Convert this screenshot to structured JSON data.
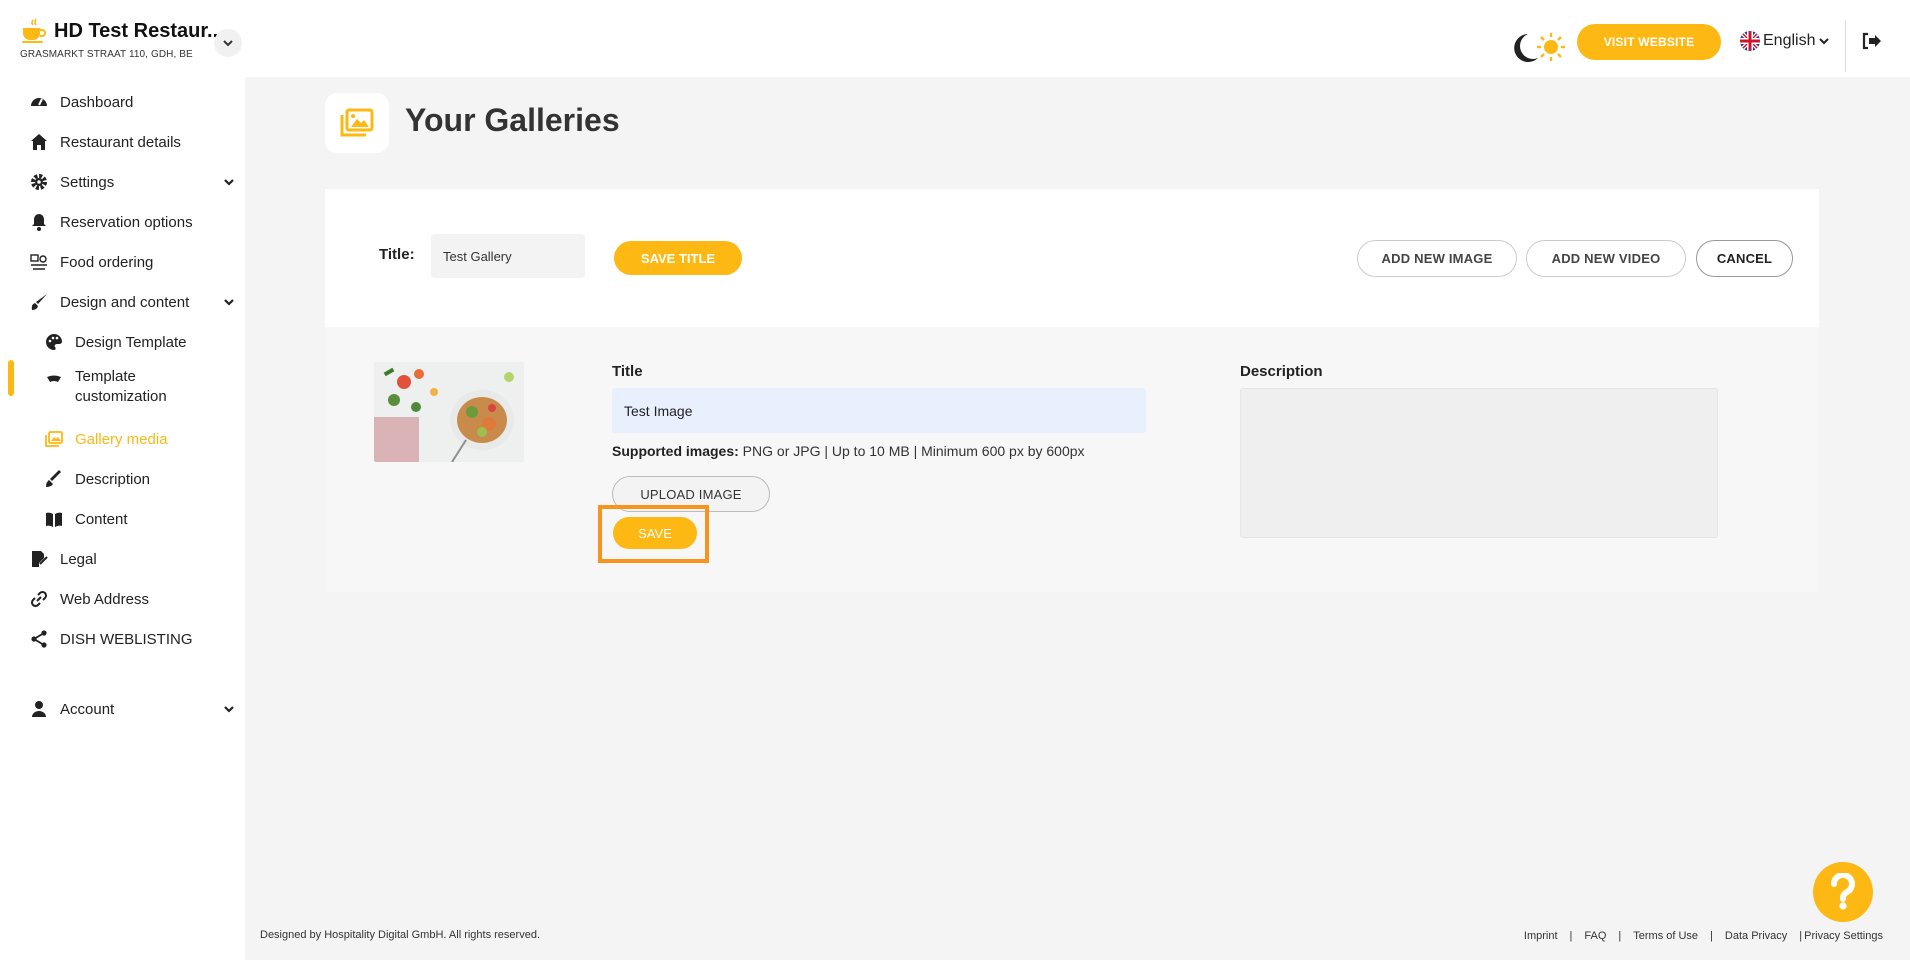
{
  "header": {
    "restaurant_name": "HD Test Restaur...",
    "address": "GRASMARKT STRAAT 110, GDH, BE",
    "visit_website": "VISIT WEBSITE",
    "language": "English"
  },
  "sidebar": {
    "items": [
      {
        "label": "Dashboard",
        "icon": "dashboard-icon"
      },
      {
        "label": "Restaurant details",
        "icon": "home-icon"
      },
      {
        "label": "Settings",
        "icon": "gear-icon"
      },
      {
        "label": "Reservation options",
        "icon": "bell-icon"
      },
      {
        "label": "Food ordering",
        "icon": "food-ordering-icon"
      },
      {
        "label": "Design and content",
        "icon": "brush-icon"
      },
      {
        "label": "Design Template",
        "icon": "palette-icon"
      },
      {
        "label_line1": "Template",
        "label_line2": "customization",
        "icon": "customization-icon"
      },
      {
        "label": "Gallery media",
        "icon": "gallery-icon"
      },
      {
        "label": "Description",
        "icon": "pen-icon"
      },
      {
        "label": "Content",
        "icon": "book-icon"
      },
      {
        "label": "Legal",
        "icon": "legal-icon"
      },
      {
        "label": "Web Address",
        "icon": "link-icon"
      },
      {
        "label": "DISH WEBLISTING",
        "icon": "share-icon"
      },
      {
        "label": "Account",
        "icon": "user-icon"
      }
    ]
  },
  "page": {
    "title": "Your Galleries"
  },
  "gallery": {
    "title_label": "Title:",
    "title_value": "Test Gallery",
    "save_title": "SAVE TITLE",
    "add_image": "ADD NEW IMAGE",
    "add_video": "ADD NEW VIDEO",
    "cancel": "CANCEL"
  },
  "image_item": {
    "title_label": "Title",
    "title_value": "Test Image",
    "supported_label": "Supported images:",
    "supported_text": " PNG or JPG | Up to 10 MB | Minimum 600 px by 600px",
    "upload": "UPLOAD IMAGE",
    "save": "SAVE",
    "description_label": "Description",
    "description_value": ""
  },
  "footer": {
    "copyright": "Designed by Hospitality Digital GmbH. All rights reserved.",
    "links": [
      "Imprint",
      "FAQ",
      "Terms of Use",
      "Data Privacy",
      "Privacy Settings"
    ]
  },
  "colors": {
    "accent": "#fdb813",
    "highlight": "#f7941d"
  }
}
